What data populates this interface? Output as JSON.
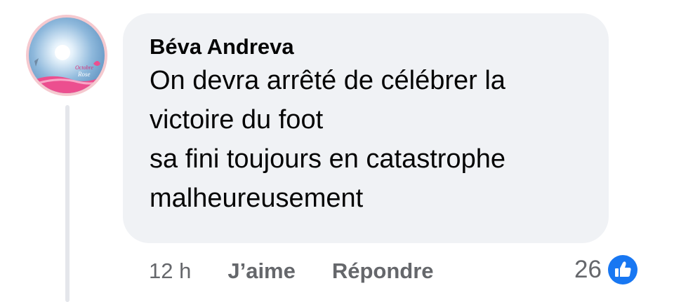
{
  "comment": {
    "author": "Béva Andreva",
    "lines": [
      "On devra arrêté de célébrer la",
      "victoire du foot",
      "sa fini toujours en catastrophe",
      "malheureusement"
    ],
    "timestamp": "12 h",
    "like_label": "J’aime",
    "reply_label": "Répondre",
    "reaction_count": "26",
    "reaction_icon": "thumbs-up-icon",
    "avatar_caption": "Octobre Rose"
  },
  "colors": {
    "bubble_bg": "#f0f2f5",
    "text_primary": "#050505",
    "text_secondary": "#65676b",
    "like_blue": "#1877f2",
    "thread_line": "#e4e6eb"
  }
}
